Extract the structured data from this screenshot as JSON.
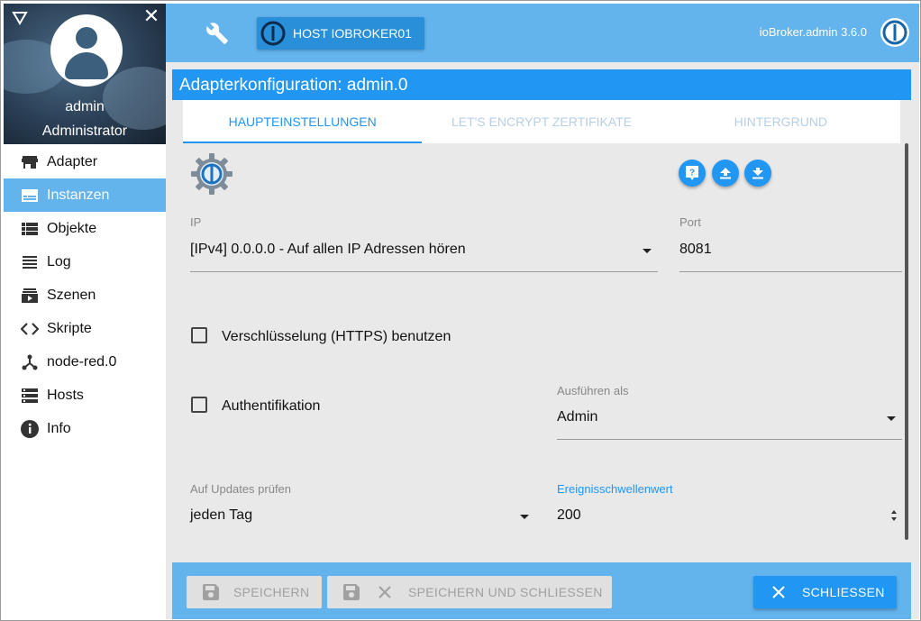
{
  "sidebar": {
    "user_name": "admin",
    "user_role": "Administrator",
    "items": [
      {
        "label": "Adapter",
        "icon": "store-icon"
      },
      {
        "label": "Instanzen",
        "icon": "instances-icon"
      },
      {
        "label": "Objekte",
        "icon": "list-icon"
      },
      {
        "label": "Log",
        "icon": "lines-icon"
      },
      {
        "label": "Szenen",
        "icon": "scenes-icon"
      },
      {
        "label": "Skripte",
        "icon": "code-icon"
      },
      {
        "label": "node-red.0",
        "icon": "node-icon"
      },
      {
        "label": "Hosts",
        "icon": "hosts-icon"
      },
      {
        "label": "Info",
        "icon": "info-icon"
      }
    ],
    "active_item": "Instanzen"
  },
  "topbar": {
    "host_button": "HOST IOBROKER01",
    "version": "ioBroker.admin 3.6.0"
  },
  "dialog": {
    "title": "Adapterkonfiguration: admin.0",
    "tabs": [
      "HAUPTEINSTELLUNGEN",
      "LET'S ENCRYPT ZERTIFIKATE",
      "HINTERGRUND"
    ],
    "active_tab": "HAUPTEINSTELLUNGEN"
  },
  "form": {
    "ip_label": "IP",
    "ip_value": "[IPv4] 0.0.0.0 - Auf allen IP Adressen hören",
    "port_label": "Port",
    "port_value": "8081",
    "https_label": "Verschlüsselung (HTTPS) benutzen",
    "https_checked": false,
    "auth_label": "Authentifikation",
    "auth_checked": false,
    "run_as_label": "Ausführen als",
    "run_as_value": "Admin",
    "updates_label": "Auf Updates prüfen",
    "updates_value": "jeden Tag",
    "threshold_label": "Ereignisschwellenwert",
    "threshold_value": "200"
  },
  "footer": {
    "save": "SPEICHERN",
    "save_close": "SPEICHERN UND SCHLIESSEN",
    "close": "SCHLIESSEN"
  },
  "colors": {
    "accent": "#2196f3",
    "bar": "#63b3ed"
  }
}
